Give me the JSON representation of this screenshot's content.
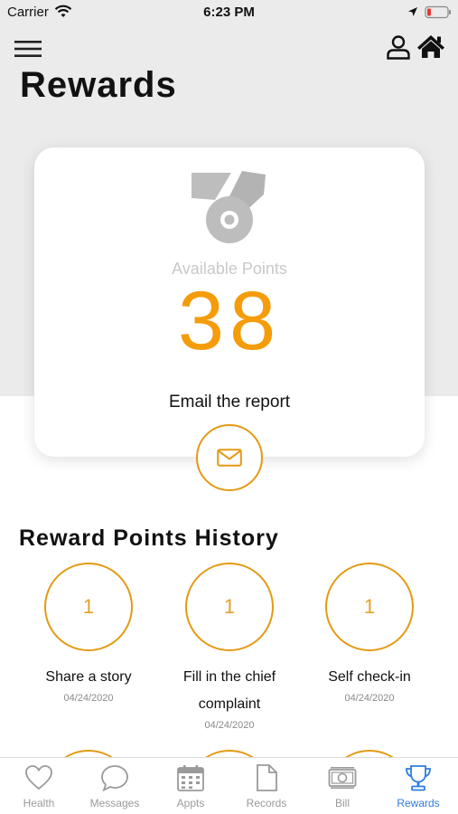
{
  "status_bar": {
    "carrier": "Carrier",
    "time": "6:23 PM"
  },
  "header": {
    "title": "Rewards"
  },
  "points_card": {
    "available_label": "Available Points",
    "points": "38",
    "email_label": "Email the report"
  },
  "history": {
    "title": "Reward Points History",
    "items": [
      {
        "points": "1",
        "label": "Share a story",
        "date": "04/24/2020"
      },
      {
        "points": "1",
        "label": "Fill in the chief complaint",
        "date": "04/24/2020"
      },
      {
        "points": "1",
        "label": "Self check-in",
        "date": "04/24/2020"
      }
    ]
  },
  "tabs": [
    {
      "label": "Health",
      "icon": "heart-icon"
    },
    {
      "label": "Messages",
      "icon": "chat-bubble-icon"
    },
    {
      "label": "Appts",
      "icon": "calendar-icon"
    },
    {
      "label": "Records",
      "icon": "document-icon"
    },
    {
      "label": "Bill",
      "icon": "cash-icon"
    },
    {
      "label": "Rewards",
      "icon": "trophy-icon",
      "active": true
    }
  ],
  "colors": {
    "accent": "#f59c0a",
    "circle_border": "#e39a14",
    "active_tab": "#2f7de1",
    "inactive_tab": "#9a9a9a",
    "header_bg": "#ebebeb"
  }
}
